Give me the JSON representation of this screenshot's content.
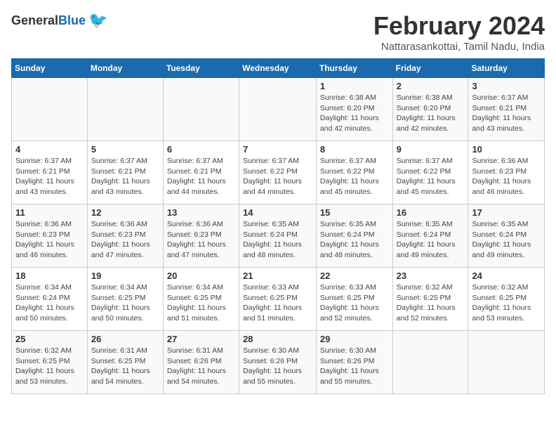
{
  "header": {
    "logo_general": "General",
    "logo_blue": "Blue",
    "title": "February 2024",
    "location": "Nattarasankottai, Tamil Nadu, India"
  },
  "days_of_week": [
    "Sunday",
    "Monday",
    "Tuesday",
    "Wednesday",
    "Thursday",
    "Friday",
    "Saturday"
  ],
  "weeks": [
    [
      {
        "day": "",
        "info": ""
      },
      {
        "day": "",
        "info": ""
      },
      {
        "day": "",
        "info": ""
      },
      {
        "day": "",
        "info": ""
      },
      {
        "day": "1",
        "info": "Sunrise: 6:38 AM\nSunset: 6:20 PM\nDaylight: 11 hours\nand 42 minutes."
      },
      {
        "day": "2",
        "info": "Sunrise: 6:38 AM\nSunset: 6:20 PM\nDaylight: 11 hours\nand 42 minutes."
      },
      {
        "day": "3",
        "info": "Sunrise: 6:37 AM\nSunset: 6:21 PM\nDaylight: 11 hours\nand 43 minutes."
      }
    ],
    [
      {
        "day": "4",
        "info": "Sunrise: 6:37 AM\nSunset: 6:21 PM\nDaylight: 11 hours\nand 43 minutes."
      },
      {
        "day": "5",
        "info": "Sunrise: 6:37 AM\nSunset: 6:21 PM\nDaylight: 11 hours\nand 43 minutes."
      },
      {
        "day": "6",
        "info": "Sunrise: 6:37 AM\nSunset: 6:21 PM\nDaylight: 11 hours\nand 44 minutes."
      },
      {
        "day": "7",
        "info": "Sunrise: 6:37 AM\nSunset: 6:22 PM\nDaylight: 11 hours\nand 44 minutes."
      },
      {
        "day": "8",
        "info": "Sunrise: 6:37 AM\nSunset: 6:22 PM\nDaylight: 11 hours\nand 45 minutes."
      },
      {
        "day": "9",
        "info": "Sunrise: 6:37 AM\nSunset: 6:22 PM\nDaylight: 11 hours\nand 45 minutes."
      },
      {
        "day": "10",
        "info": "Sunrise: 6:36 AM\nSunset: 6:23 PM\nDaylight: 11 hours\nand 46 minutes."
      }
    ],
    [
      {
        "day": "11",
        "info": "Sunrise: 6:36 AM\nSunset: 6:23 PM\nDaylight: 11 hours\nand 46 minutes."
      },
      {
        "day": "12",
        "info": "Sunrise: 6:36 AM\nSunset: 6:23 PM\nDaylight: 11 hours\nand 47 minutes."
      },
      {
        "day": "13",
        "info": "Sunrise: 6:36 AM\nSunset: 6:23 PM\nDaylight: 11 hours\nand 47 minutes."
      },
      {
        "day": "14",
        "info": "Sunrise: 6:35 AM\nSunset: 6:24 PM\nDaylight: 11 hours\nand 48 minutes."
      },
      {
        "day": "15",
        "info": "Sunrise: 6:35 AM\nSunset: 6:24 PM\nDaylight: 11 hours\nand 48 minutes."
      },
      {
        "day": "16",
        "info": "Sunrise: 6:35 AM\nSunset: 6:24 PM\nDaylight: 11 hours\nand 49 minutes."
      },
      {
        "day": "17",
        "info": "Sunrise: 6:35 AM\nSunset: 6:24 PM\nDaylight: 11 hours\nand 49 minutes."
      }
    ],
    [
      {
        "day": "18",
        "info": "Sunrise: 6:34 AM\nSunset: 6:24 PM\nDaylight: 11 hours\nand 50 minutes."
      },
      {
        "day": "19",
        "info": "Sunrise: 6:34 AM\nSunset: 6:25 PM\nDaylight: 11 hours\nand 50 minutes."
      },
      {
        "day": "20",
        "info": "Sunrise: 6:34 AM\nSunset: 6:25 PM\nDaylight: 11 hours\nand 51 minutes."
      },
      {
        "day": "21",
        "info": "Sunrise: 6:33 AM\nSunset: 6:25 PM\nDaylight: 11 hours\nand 51 minutes."
      },
      {
        "day": "22",
        "info": "Sunrise: 6:33 AM\nSunset: 6:25 PM\nDaylight: 11 hours\nand 52 minutes."
      },
      {
        "day": "23",
        "info": "Sunrise: 6:32 AM\nSunset: 6:25 PM\nDaylight: 11 hours\nand 52 minutes."
      },
      {
        "day": "24",
        "info": "Sunrise: 6:32 AM\nSunset: 6:25 PM\nDaylight: 11 hours\nand 53 minutes."
      }
    ],
    [
      {
        "day": "25",
        "info": "Sunrise: 6:32 AM\nSunset: 6:25 PM\nDaylight: 11 hours\nand 53 minutes."
      },
      {
        "day": "26",
        "info": "Sunrise: 6:31 AM\nSunset: 6:25 PM\nDaylight: 11 hours\nand 54 minutes."
      },
      {
        "day": "27",
        "info": "Sunrise: 6:31 AM\nSunset: 6:26 PM\nDaylight: 11 hours\nand 54 minutes."
      },
      {
        "day": "28",
        "info": "Sunrise: 6:30 AM\nSunset: 6:26 PM\nDaylight: 11 hours\nand 55 minutes."
      },
      {
        "day": "29",
        "info": "Sunrise: 6:30 AM\nSunset: 6:26 PM\nDaylight: 11 hours\nand 55 minutes."
      },
      {
        "day": "",
        "info": ""
      },
      {
        "day": "",
        "info": ""
      }
    ]
  ]
}
